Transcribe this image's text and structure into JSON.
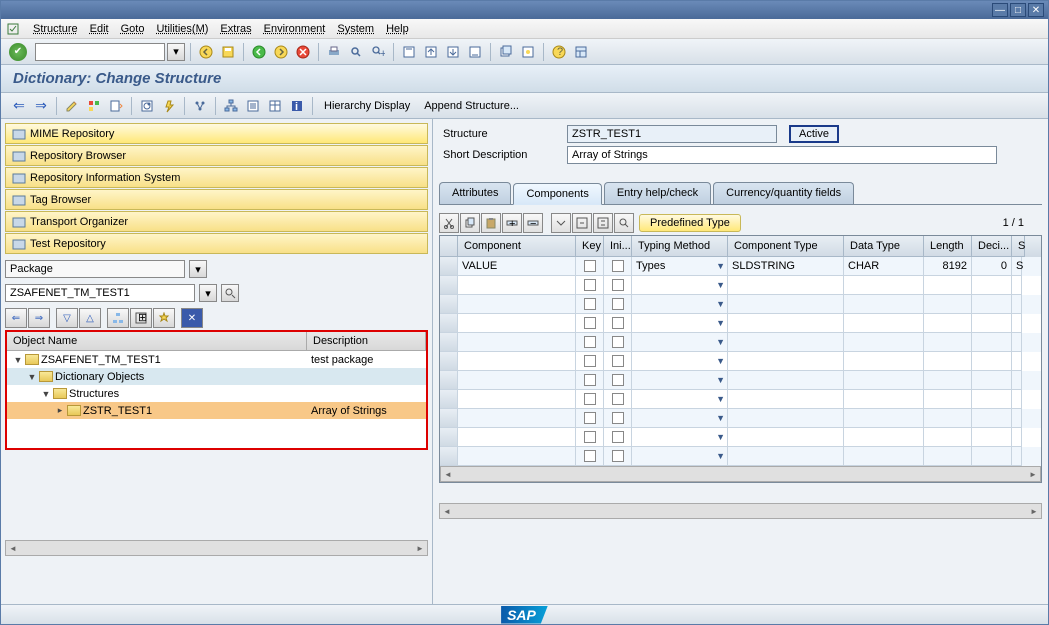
{
  "menus": [
    "Structure",
    "Edit",
    "Goto",
    "Utilities(M)",
    "Extras",
    "Environment",
    "System",
    "Help"
  ],
  "title": "Dictionary: Change Structure",
  "toolbar2": {
    "hierarchy": "Hierarchy Display",
    "append": "Append Structure..."
  },
  "navButtons": [
    {
      "label": "MIME Repository",
      "icon": "mime"
    },
    {
      "label": "Repository Browser",
      "icon": "repo"
    },
    {
      "label": "Repository Information System",
      "icon": "info"
    },
    {
      "label": "Tag Browser",
      "icon": "tag"
    },
    {
      "label": "Transport Organizer",
      "icon": "transport"
    },
    {
      "label": "Test Repository",
      "icon": "test"
    }
  ],
  "packageLabel": "Package",
  "packageValue": "ZSAFENET_TM_TEST1",
  "treeHeaders": {
    "c1": "Object Name",
    "c2": "Description"
  },
  "tree": [
    {
      "indent": 0,
      "name": "ZSAFENET_TM_TEST1",
      "desc": "test package",
      "expanded": true
    },
    {
      "indent": 1,
      "name": "Dictionary Objects",
      "desc": "",
      "expanded": true
    },
    {
      "indent": 2,
      "name": "Structures",
      "desc": "",
      "expanded": true
    },
    {
      "indent": 3,
      "name": "ZSTR_TEST1",
      "desc": "Array of Strings",
      "selected": true
    }
  ],
  "form": {
    "structLabel": "Structure",
    "structValue": "ZSTR_TEST1",
    "status": "Active",
    "shortLabel": "Short Description",
    "shortValue": "Array of Strings"
  },
  "tabs": [
    "Attributes",
    "Components",
    "Entry help/check",
    "Currency/quantity fields"
  ],
  "activeTab": 1,
  "predefBtn": "Predefined Type",
  "pageIndicator": "1 / 1",
  "gridCols": [
    {
      "label": "",
      "w": 18
    },
    {
      "label": "Component",
      "w": 118
    },
    {
      "label": "Key",
      "w": 28
    },
    {
      "label": "Ini...",
      "w": 28
    },
    {
      "label": "Typing Method",
      "w": 96
    },
    {
      "label": "Component Type",
      "w": 116
    },
    {
      "label": "Data Type",
      "w": 80
    },
    {
      "label": "Length",
      "w": 48
    },
    {
      "label": "Deci...",
      "w": 40
    },
    {
      "label": "S",
      "w": 10
    }
  ],
  "gridRows": [
    {
      "component": "VALUE",
      "key": false,
      "ini": false,
      "typing": "Types",
      "ctype": "SLDSTRING",
      "dtype": "CHAR",
      "len": "8192",
      "dec": "0",
      "s": "S"
    }
  ],
  "emptyRows": 10
}
